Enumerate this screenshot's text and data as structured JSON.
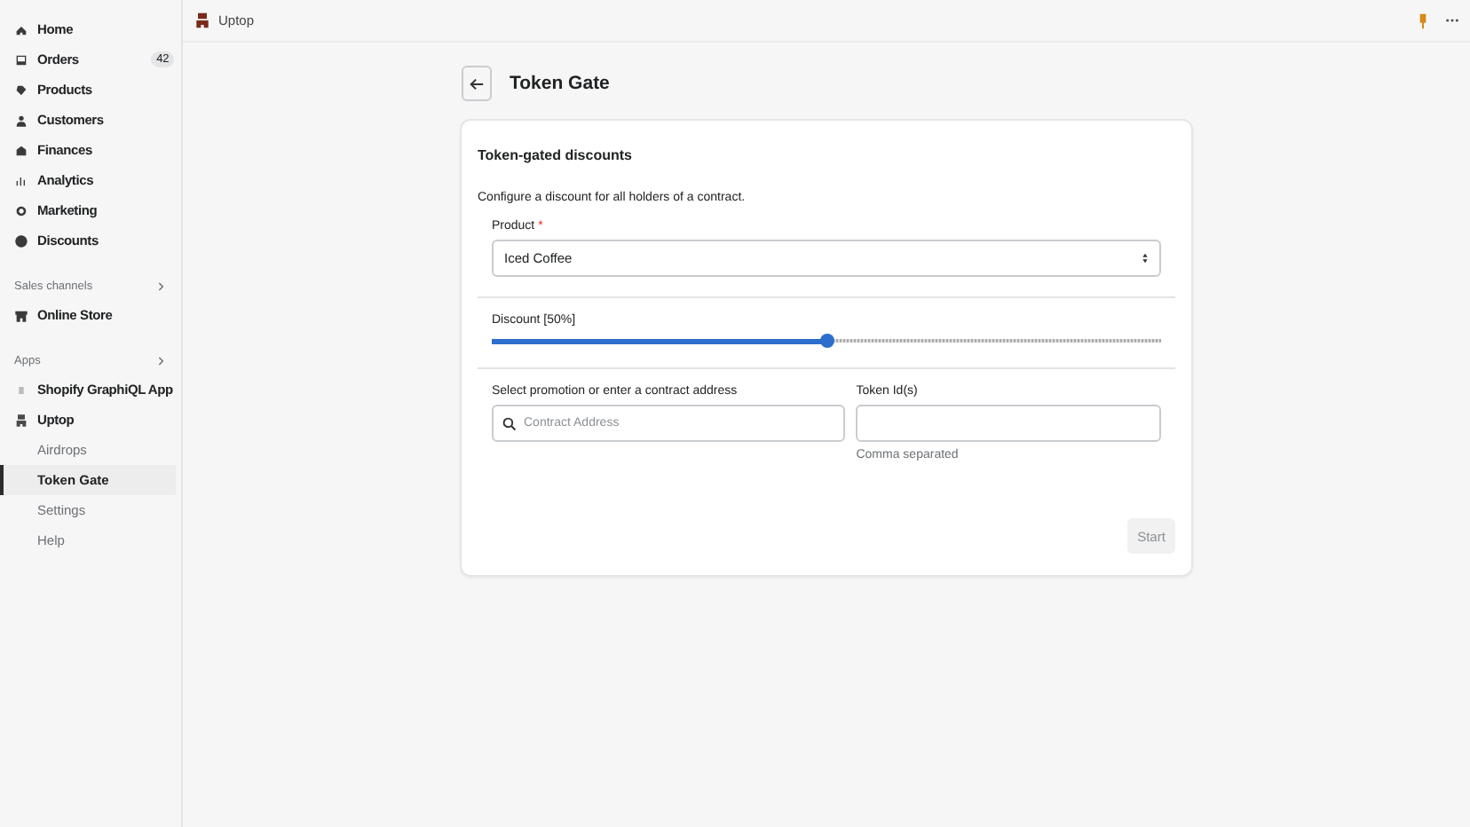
{
  "nav": [
    {
      "label": "Home"
    },
    {
      "label": "Orders",
      "badge": "42"
    },
    {
      "label": "Products"
    },
    {
      "label": "Customers"
    },
    {
      "label": "Finances"
    },
    {
      "label": "Analytics"
    },
    {
      "label": "Marketing"
    },
    {
      "label": "Discounts"
    }
  ],
  "sales_channels": {
    "title": "Sales channels",
    "items": [
      {
        "label": "Online Store"
      }
    ]
  },
  "apps": {
    "title": "Apps",
    "items": [
      {
        "label": "Shopify GraphiQL App"
      },
      {
        "label": "Uptop",
        "children": [
          {
            "label": "Airdrops",
            "selected": false
          },
          {
            "label": "Token Gate",
            "selected": true
          },
          {
            "label": "Settings",
            "selected": false
          },
          {
            "label": "Help",
            "selected": false
          }
        ]
      }
    ]
  },
  "top_bar": {
    "app_name": "Uptop"
  },
  "page": {
    "title": "Token Gate"
  },
  "card": {
    "title": "Token-gated discounts",
    "description": "Configure a discount for all holders of a contract.",
    "product": {
      "label": "Product",
      "required_mark": "*",
      "value": "Iced Coffee"
    },
    "discount": {
      "label": "Discount [50%]",
      "level": 0.5
    },
    "contract": {
      "label": "Select promotion or enter a contract address",
      "placeholder": "Contract Address"
    },
    "token_ids": {
      "label": "Token Id(s)",
      "help": "Comma separated"
    },
    "start_button": {
      "label": "Start",
      "disabled": true
    }
  }
}
